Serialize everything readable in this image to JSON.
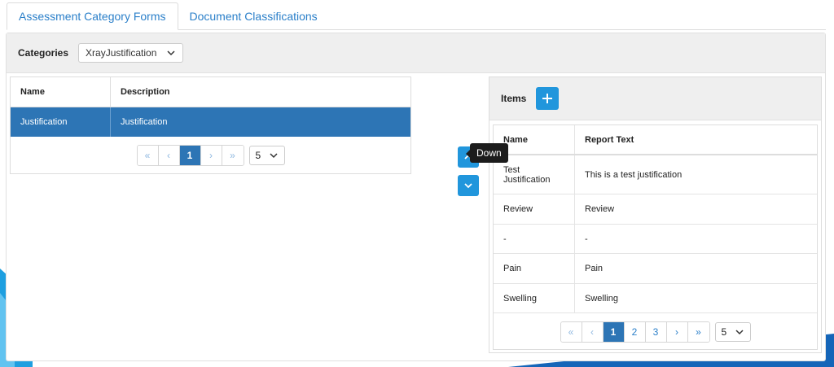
{
  "tabs": [
    {
      "label": "Assessment Category Forms",
      "active": true
    },
    {
      "label": "Document Classifications",
      "active": false
    }
  ],
  "toolbar": {
    "categories_label": "Categories",
    "category_selected": "XrayJustification"
  },
  "left_grid": {
    "columns": [
      "Name",
      "Description"
    ],
    "rows": [
      {
        "name": "Justification",
        "description": "Justification",
        "selected": true
      }
    ],
    "pager": {
      "first": "«",
      "prev": "‹",
      "pages": [
        "1"
      ],
      "current": "1",
      "next": "›",
      "last": "»",
      "page_size": "5"
    }
  },
  "move": {
    "up_icon": "chevron-up-icon",
    "down_icon": "chevron-down-icon",
    "tooltip": "Down"
  },
  "items": {
    "title": "Items",
    "columns": [
      "Name",
      "Report Text"
    ],
    "rows": [
      {
        "name": "Test\nJustification",
        "report": "This is a test justification"
      },
      {
        "name": "Review",
        "report": "Review"
      },
      {
        "name": "-",
        "report": "-"
      },
      {
        "name": "Pain",
        "report": "Pain"
      },
      {
        "name": "Swelling",
        "report": "Swelling"
      }
    ],
    "pager": {
      "first": "«",
      "prev": "‹",
      "pages": [
        "1",
        "2",
        "3"
      ],
      "current": "1",
      "next": "›",
      "last": "»",
      "page_size": "5"
    }
  },
  "colors": {
    "accent": "#2196dc",
    "selected_row": "#2d75b5",
    "tab_text": "#2a7fc9"
  }
}
